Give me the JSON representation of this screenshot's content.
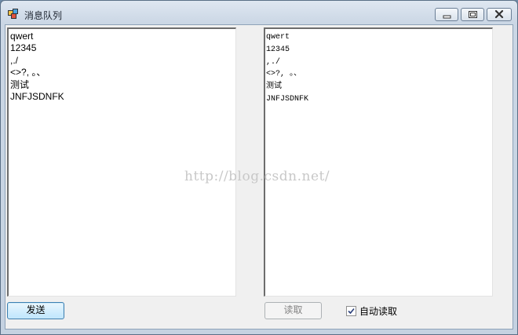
{
  "window": {
    "title": "消息队列",
    "controls": [
      "minimize-icon",
      "maximize-icon",
      "close-icon"
    ]
  },
  "left_textbox": {
    "lines": [
      "qwert",
      "12345",
      ",./",
      "<>?, 。、",
      "测试",
      "JNFJSDNFK"
    ]
  },
  "right_textbox": {
    "lines": [
      "qwert",
      "12345",
      ",./",
      "<>?, 。、",
      "测试",
      "JNFJSDNFK"
    ]
  },
  "send_button": {
    "label": "发送"
  },
  "read_button": {
    "label": "读取",
    "enabled": false
  },
  "auto_read": {
    "label": "自动读取",
    "checked": true
  },
  "watermark": "http://blog.csdn.net/",
  "colors": {
    "titlebar": "#cbd7e5",
    "client_bg": "#f0f0f0",
    "focus_border": "#3c7fb1"
  }
}
